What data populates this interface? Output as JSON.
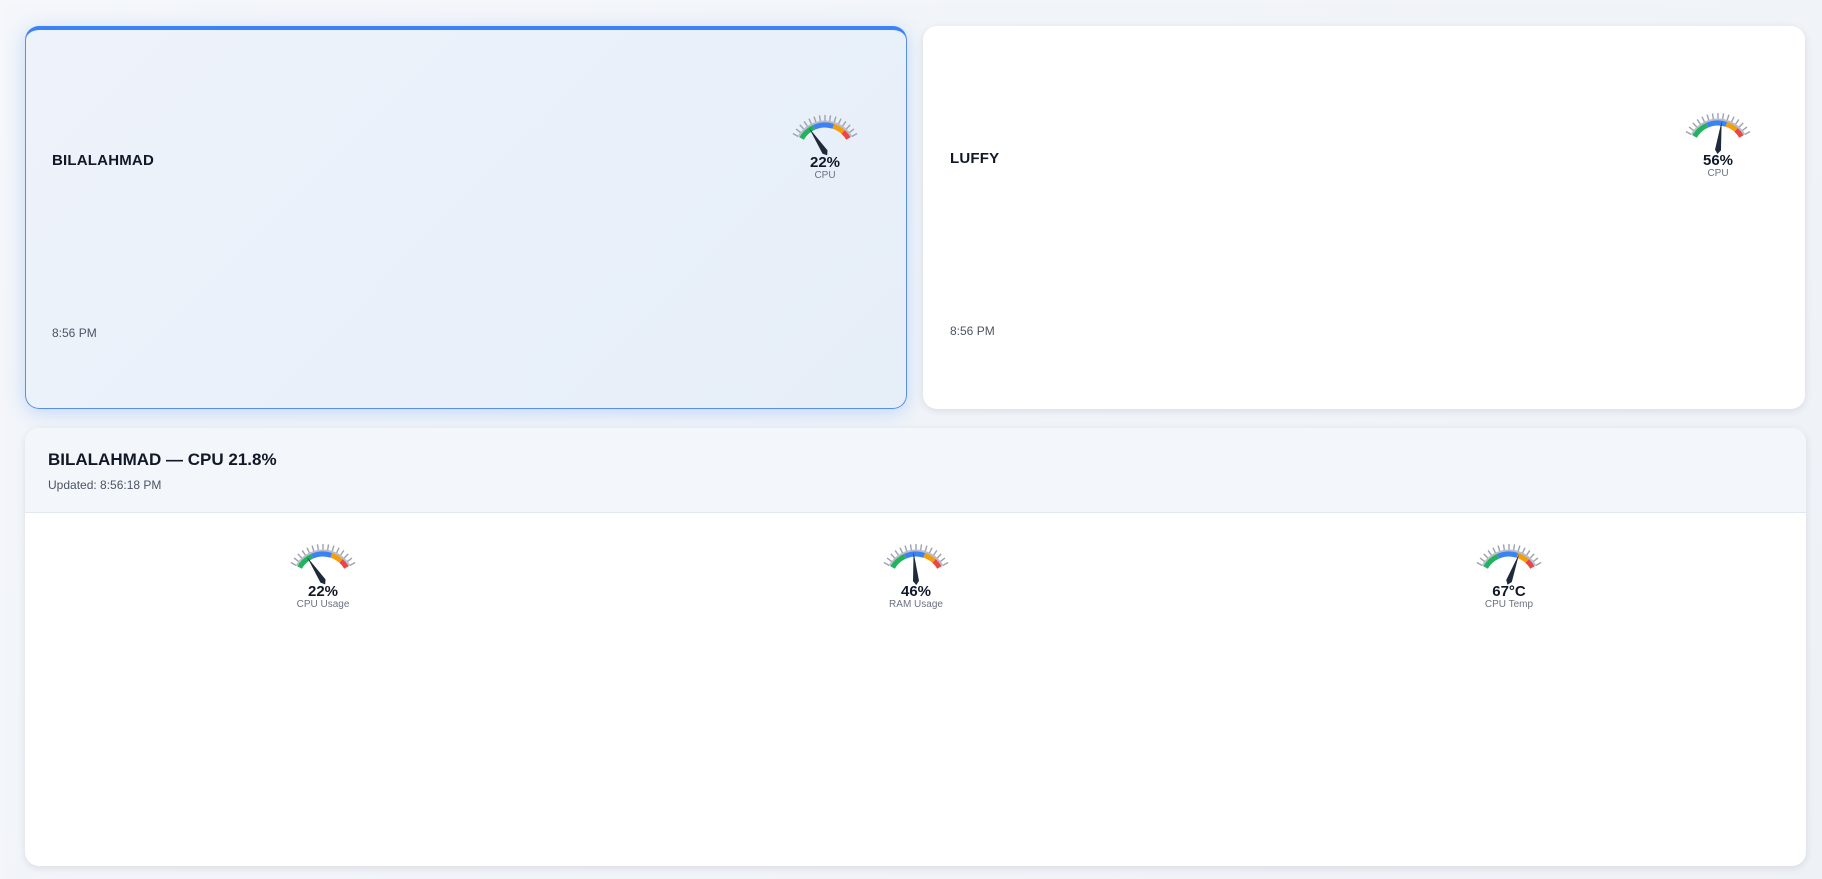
{
  "machines": [
    {
      "name": "BILALAHMAD",
      "time": "8:56 PM",
      "gauge": {
        "value_text": "22%",
        "label": "CPU",
        "value": 22,
        "max": 100
      }
    },
    {
      "name": "LUFFY",
      "time": "8:56 PM",
      "gauge": {
        "value_text": "56%",
        "label": "CPU",
        "value": 56,
        "max": 100
      }
    }
  ],
  "detail": {
    "title": "BILALAHMAD — CPU 21.8%",
    "updated": "Updated: 8:56:18 PM",
    "gauges": [
      {
        "value_text": "22%",
        "label": "CPU Usage",
        "value": 22,
        "max": 100
      },
      {
        "value_text": "46%",
        "label": "RAM Usage",
        "value": 46,
        "max": 100
      },
      {
        "value_text": "67°C",
        "label": "CPU Temp",
        "value": 67,
        "max": 100
      }
    ]
  },
  "colors": {
    "accent": "#3b82f6",
    "zone_green": "#22b35e",
    "zone_blue": "#3b82f6",
    "zone_orange": "#f59e0b",
    "zone_red": "#ef4444",
    "needle": "#1e293b"
  }
}
